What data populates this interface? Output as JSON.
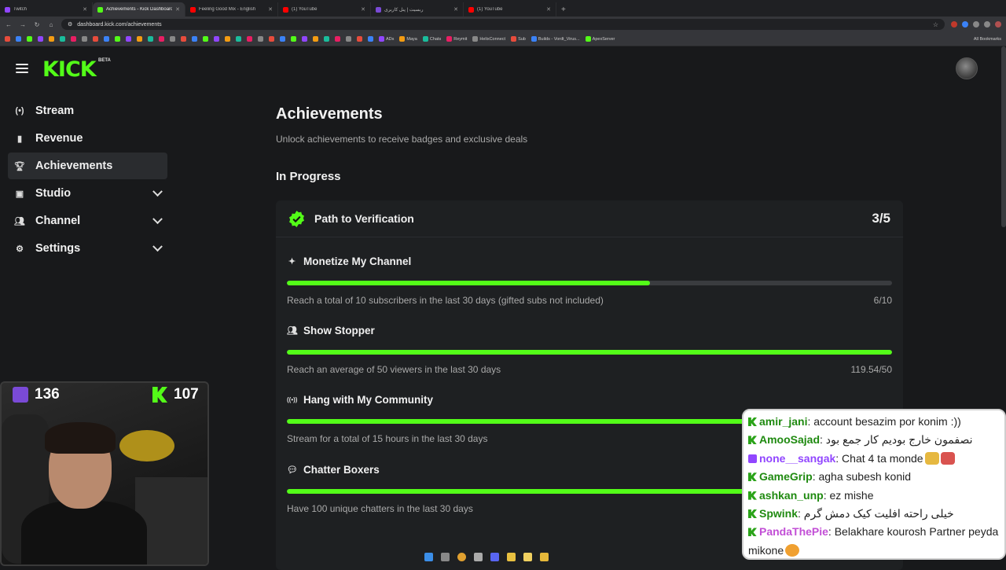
{
  "browser": {
    "tabs": [
      {
        "title": "Twitch",
        "color": "#9146ff"
      },
      {
        "title": "Achievements - Kick Dashboard",
        "color": "#53fc18",
        "active": true
      },
      {
        "title": "Feeling Good Mix - English",
        "color": "#ff0000"
      },
      {
        "title": "(1) YouTube",
        "color": "#ff0000"
      },
      {
        "title": "ربسیت | پنل کاربری",
        "color": "#7a4ad6"
      },
      {
        "title": "(1) YouTube",
        "color": "#ff0000"
      }
    ],
    "url": "dashboard.kick.com/achievements",
    "bookmarks": [
      "ADs",
      "Maya",
      "Chats",
      "Reymit",
      "HelixConnect",
      "Sub",
      "Builds - Vordt_Virus...",
      "ApexServer"
    ],
    "all_bookmarks": "All Bookmarks"
  },
  "header": {
    "logo": "KICK",
    "beta": "BETA"
  },
  "sidebar": {
    "items": [
      {
        "label": "Stream",
        "icon": "stream-icon"
      },
      {
        "label": "Revenue",
        "icon": "revenue-icon"
      },
      {
        "label": "Achievements",
        "icon": "trophy-icon",
        "active": true
      },
      {
        "label": "Studio",
        "icon": "studio-icon",
        "expandable": true
      },
      {
        "label": "Channel",
        "icon": "channel-icon",
        "expandable": true
      },
      {
        "label": "Settings",
        "icon": "settings-icon",
        "expandable": true
      }
    ]
  },
  "main": {
    "title": "Achievements",
    "subtitle": "Unlock achievements to receive badges and exclusive deals",
    "section": "In Progress",
    "card": {
      "title": "Path to Verification",
      "count": "3/5",
      "achievements": [
        {
          "title": "Monetize My Channel",
          "icon": "sparkle-icon",
          "desc": "Reach a total of 10 subscribers in the last 30 days (gifted subs not included)",
          "progress_text": "6/10",
          "progress": 0.6
        },
        {
          "title": "Show Stopper",
          "icon": "viewers-icon",
          "desc": "Reach an average of 50 viewers in the last 30 days",
          "progress_text": "119.54/50",
          "progress": 1.0
        },
        {
          "title": "Hang with My Community",
          "icon": "broadcast-icon",
          "desc": "Stream for a total of 15 hours in the last 30 days",
          "progress_text": "",
          "progress": 1.0
        },
        {
          "title": "Chatter Boxers",
          "icon": "chat-bubble-icon",
          "desc": "Have 100 unique chatters in the last 30 days",
          "progress_text": "",
          "progress": 1.0
        }
      ]
    }
  },
  "overlay": {
    "twitch_viewers": "136",
    "kick_viewers": "107",
    "chat": [
      {
        "platform": "kick",
        "user": "amir_jani",
        "text": ": account besazim por konim :))"
      },
      {
        "platform": "kick",
        "user": "AmooSajad",
        "text": ": نصفمون خارج بودیم کار جمع بود"
      },
      {
        "platform": "twitch",
        "user": "none__sangak",
        "text": ": Chat 4 ta monde"
      },
      {
        "platform": "kick",
        "user": "GameGrip",
        "text": ": agha subesh konid"
      },
      {
        "platform": "kick",
        "user": "ashkan_unp",
        "text": ": ez mishe"
      },
      {
        "platform": "kick",
        "user": "Spwink",
        "text": ": خیلی راحته افلیت کیک دمش گرم"
      },
      {
        "platform": "kick",
        "user": "PandaThePie",
        "text": ": Belakhare kourosh Partner peyda mikone",
        "pink": true
      }
    ]
  }
}
